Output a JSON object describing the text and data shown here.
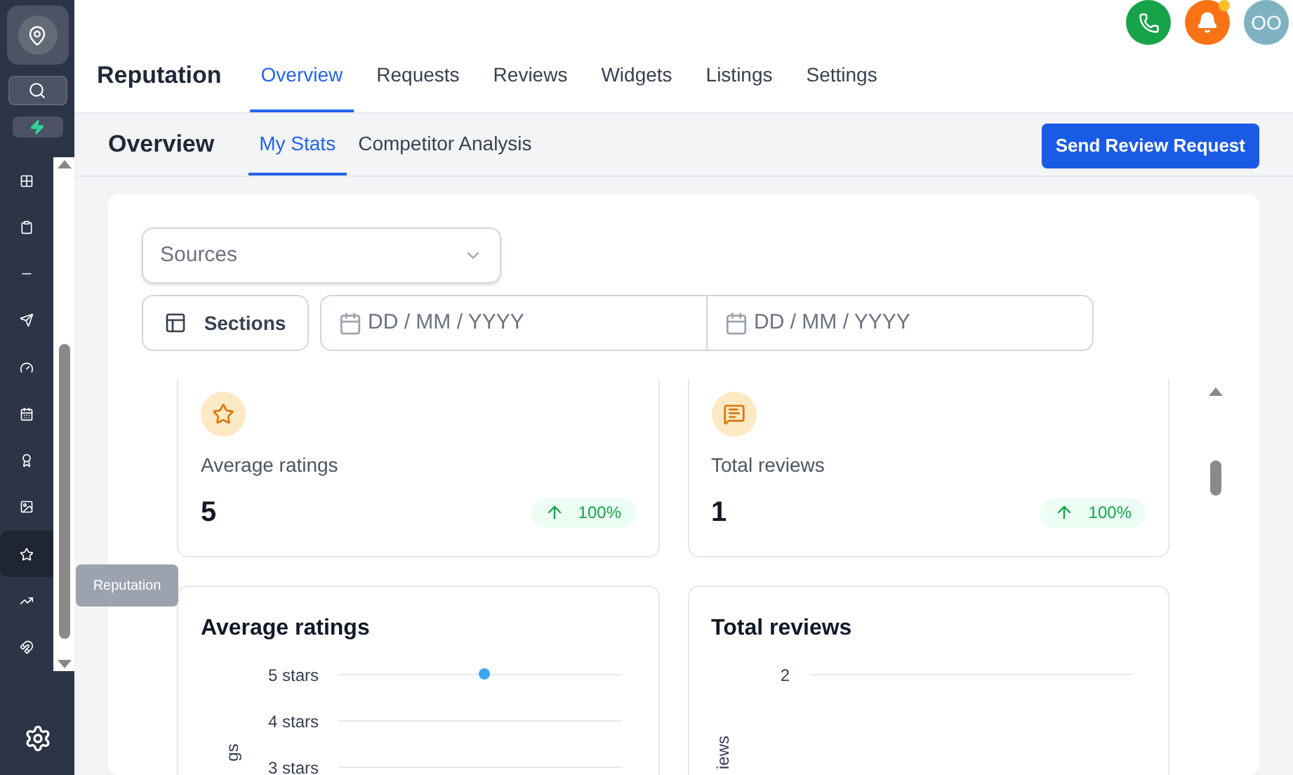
{
  "sidebar": {
    "items": [
      {
        "selected": false
      },
      {
        "selected": false
      },
      {
        "selected": false
      },
      {
        "selected": false
      },
      {
        "selected": false
      },
      {
        "selected": false
      },
      {
        "selected": false
      },
      {
        "selected": false
      },
      {
        "selected": true
      },
      {
        "selected": false
      },
      {
        "selected": false
      }
    ],
    "tooltip": "Reputation"
  },
  "header": {
    "notifications_unread": true,
    "avatar": "OO",
    "title": "Reputation",
    "tabs": [
      {
        "label": "Overview",
        "selected": true
      },
      {
        "label": "Requests",
        "selected": false
      },
      {
        "label": "Reviews",
        "selected": false
      },
      {
        "label": "Widgets",
        "selected": false
      },
      {
        "label": "Listings",
        "selected": false
      },
      {
        "label": "Settings",
        "selected": false
      }
    ]
  },
  "subheader": {
    "title": "Overview",
    "tabs": [
      {
        "label": "My Stats",
        "selected": true
      },
      {
        "label": "Competitor Analysis",
        "selected": false
      }
    ],
    "button": "Send Review Request"
  },
  "filters": {
    "sources": {
      "placeholder": "Sources"
    },
    "sections_button": "Sections",
    "date_from": {
      "placeholder": "DD / MM / YYYY"
    },
    "date_to": {
      "placeholder": "DD / MM / YYYY"
    }
  },
  "stats": [
    {
      "label": "Average ratings",
      "value": "5",
      "change": "100%"
    },
    {
      "label": "Total reviews",
      "value": "1",
      "change": "100%"
    }
  ],
  "charts": [
    {
      "title": "Average ratings",
      "y_labels": [
        "5 stars",
        "4 stars",
        "3 stars"
      ],
      "y_axis_title": "gs"
    },
    {
      "title": "Total reviews",
      "y_labels": [
        "2"
      ],
      "y_axis_title": "iews"
    }
  ]
}
